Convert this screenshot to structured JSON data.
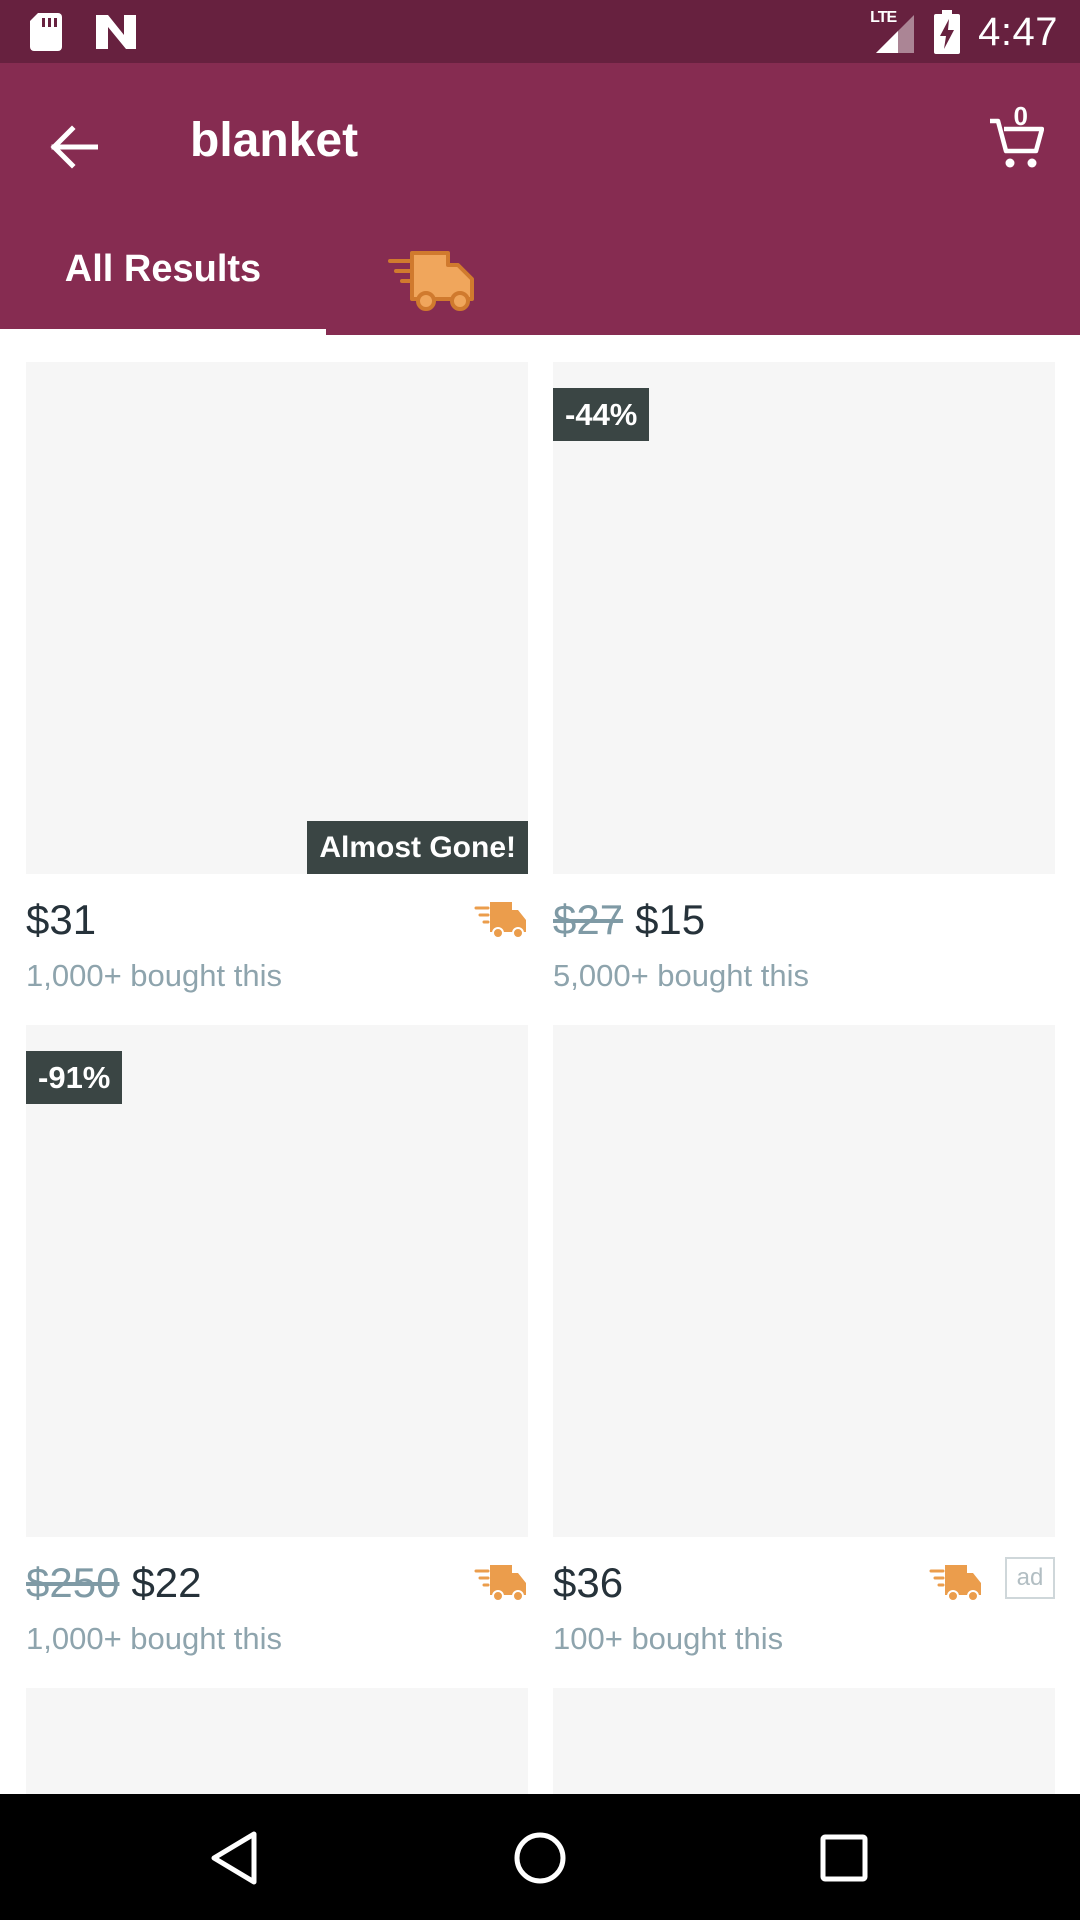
{
  "status_bar": {
    "time": "4:47",
    "network": "LTE",
    "icons": [
      "sd-card-icon",
      "n-logo-icon",
      "lte-signal-icon",
      "battery-charging-icon"
    ]
  },
  "app_bar": {
    "title": "blanket",
    "cart_count": "0",
    "tabs": [
      {
        "label": "All Results",
        "selected": true
      },
      {
        "icon": "express-truck-icon",
        "selected": false
      }
    ]
  },
  "products": [
    {
      "price": "$31",
      "original_price": "",
      "sold": "1,000+ bought this",
      "discount": "",
      "stock_badge": "Almost Gone!",
      "fast_shipping": true,
      "ad": false
    },
    {
      "price": "$15",
      "original_price": "$27",
      "sold": "5,000+ bought this",
      "discount": "-44%",
      "stock_badge": "",
      "fast_shipping": false,
      "ad": false
    },
    {
      "price": "$22",
      "original_price": "$250",
      "sold": "1,000+ bought this",
      "discount": "-91%",
      "stock_badge": "",
      "fast_shipping": true,
      "ad": false
    },
    {
      "price": "$36",
      "original_price": "",
      "sold": "100+ bought this",
      "discount": "",
      "stock_badge": "",
      "fast_shipping": true,
      "ad": true,
      "ad_label": "ad"
    }
  ],
  "colors": {
    "status_bar": "#67213f",
    "app_bar": "#862c51",
    "badge": "#3a4544",
    "truck": "#eb9d4c",
    "price": "#26323a",
    "muted": "#8ea4ad"
  },
  "nav_bar": {
    "buttons": [
      "back-triangle-icon",
      "home-circle-icon",
      "recents-square-icon"
    ]
  }
}
